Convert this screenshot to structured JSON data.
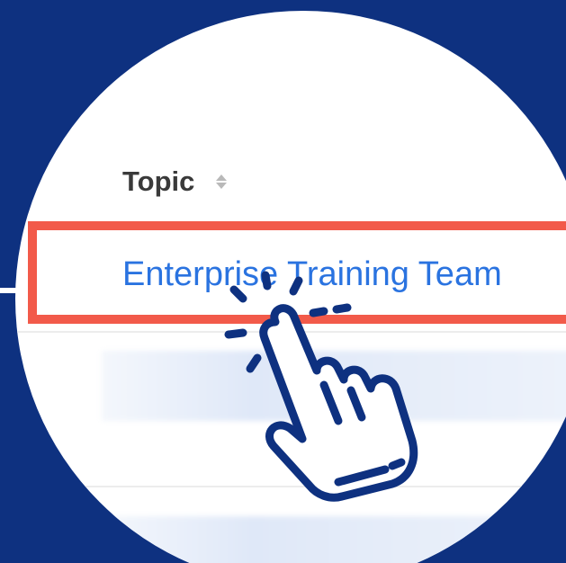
{
  "table": {
    "column_header": "Topic",
    "sort_icon": "sort-updown-icon",
    "rows": [
      {
        "topic": "Enterprise Training Team",
        "highlighted": true
      }
    ]
  },
  "overlay": {
    "cursor_icon": "pointing-hand-click-icon"
  },
  "colors": {
    "background": "#0e3180",
    "highlight_border": "#f25a4a",
    "link": "#2a73e0",
    "header_text": "#3a3a3a",
    "cursor_stroke": "#0e3180"
  }
}
